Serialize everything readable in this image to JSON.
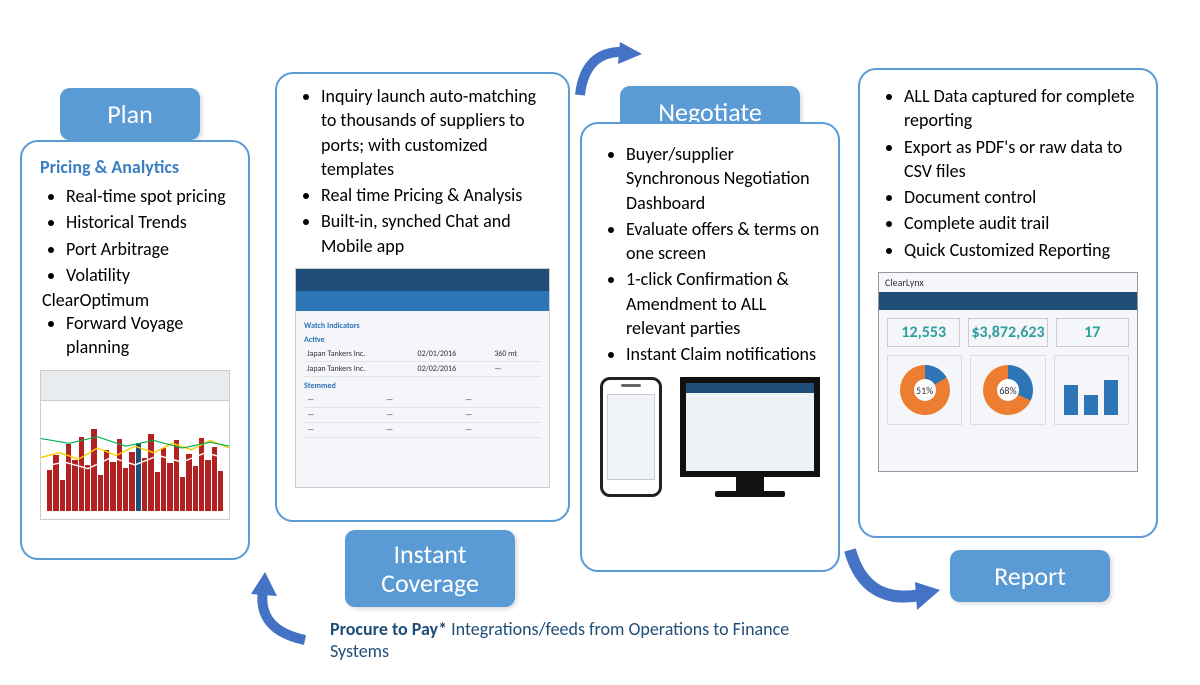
{
  "stages": {
    "plan": "Plan",
    "instant": "Instant Coverage",
    "negotiate": "Negotiate",
    "report": "Report"
  },
  "plan": {
    "heading": "Pricing & Analytics",
    "items": [
      "Real-time spot pricing",
      "Historical Trends",
      "Port Arbitrage",
      "Volatility"
    ],
    "clearopt": "ClearOptimum",
    "items2": [
      "Forward Voyage planning"
    ]
  },
  "instant": {
    "items": [
      "Inquiry launch auto-matching to thousands of suppliers to ports; with customized templates",
      "Real time Pricing & Analysis",
      "Built-in, synched Chat and Mobile app"
    ]
  },
  "instant_shot": {
    "sections": [
      "Watch Indicators",
      "Active",
      "Stemmed"
    ],
    "sample_rows": [
      [
        "Japan Tankers Inc.",
        "02/01/2016",
        "360 mt"
      ],
      [
        "Japan Tankers Inc.",
        "02/02/2016",
        "—"
      ]
    ]
  },
  "negotiate": {
    "items": [
      "Buyer/supplier Synchronous Negotiation Dashboard",
      "Evaluate offers & terms on one screen",
      "1-click Confirmation & Amendment to ALL relevant parties",
      "Instant Claim notifications"
    ]
  },
  "report": {
    "items": [
      "ALL Data captured for complete reporting",
      "Export as PDF's or raw data to CSV files",
      "Document control",
      "Complete audit trail",
      "Quick Customized Reporting"
    ]
  },
  "report_shot": {
    "brand": "ClearLynx",
    "kpis": [
      {
        "value": "12,553",
        "label": ""
      },
      {
        "value": "$3,872,623",
        "label": ""
      },
      {
        "value": "17",
        "label": ""
      }
    ],
    "donuts": [
      "51%",
      "68%"
    ],
    "bars": [
      60,
      40,
      70
    ]
  },
  "footer": {
    "bold": "Procure to Pay*",
    "rest": " Integrations/feeds from Operations to Finance Systems"
  }
}
